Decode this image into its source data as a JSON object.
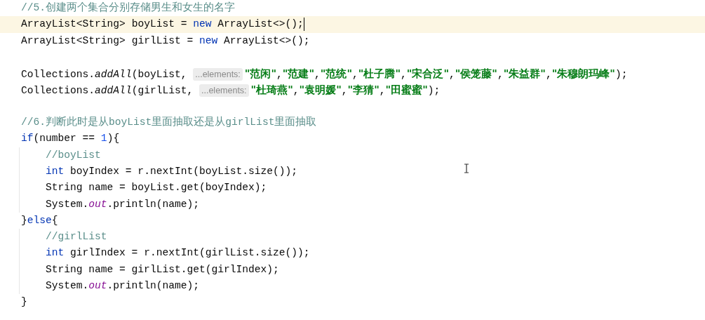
{
  "editor": {
    "lines": [
      {
        "kind": "code",
        "current": false,
        "caret": false,
        "tokens": [
          {
            "t": "//5.创建两个集合分别存储男生和女生的名字",
            "kind": "comment"
          }
        ]
      },
      {
        "kind": "code",
        "current": true,
        "caret": true,
        "tokens": [
          {
            "t": "ArrayList<String> boyList = ",
            "kind": "plain"
          },
          {
            "t": "new",
            "kind": "keyword"
          },
          {
            "t": " ArrayList<>();",
            "kind": "plain"
          }
        ]
      },
      {
        "kind": "code",
        "current": false,
        "caret": false,
        "tokens": [
          {
            "t": "ArrayList<String> girlList = ",
            "kind": "plain"
          },
          {
            "t": "new",
            "kind": "keyword"
          },
          {
            "t": " ArrayList<>();",
            "kind": "plain"
          }
        ]
      },
      {
        "kind": "blank"
      },
      {
        "kind": "code",
        "current": false,
        "caret": false,
        "tokens": [
          {
            "t": "Collections.",
            "kind": "plain"
          },
          {
            "t": "addAll",
            "kind": "static"
          },
          {
            "t": "(boyList, ",
            "kind": "plain"
          },
          {
            "t": "...elements:",
            "kind": "hint"
          },
          {
            "t": "\"范闲\"",
            "kind": "string"
          },
          {
            "t": ",",
            "kind": "plain"
          },
          {
            "t": "\"范建\"",
            "kind": "string"
          },
          {
            "t": ",",
            "kind": "plain"
          },
          {
            "t": "\"范统\"",
            "kind": "string"
          },
          {
            "t": ",",
            "kind": "plain"
          },
          {
            "t": "\"杜子腾\"",
            "kind": "string"
          },
          {
            "t": ",",
            "kind": "plain"
          },
          {
            "t": "\"宋合泛\"",
            "kind": "string"
          },
          {
            "t": ",",
            "kind": "plain"
          },
          {
            "t": "\"侯笼藤\"",
            "kind": "string"
          },
          {
            "t": ",",
            "kind": "plain"
          },
          {
            "t": "\"朱益群\"",
            "kind": "string"
          },
          {
            "t": ",",
            "kind": "plain"
          },
          {
            "t": "\"朱穆朗玛峰\"",
            "kind": "string"
          },
          {
            "t": ");",
            "kind": "plain"
          }
        ]
      },
      {
        "kind": "code",
        "current": false,
        "caret": false,
        "tokens": [
          {
            "t": "Collections.",
            "kind": "plain"
          },
          {
            "t": "addAll",
            "kind": "static"
          },
          {
            "t": "(girlList, ",
            "kind": "plain"
          },
          {
            "t": "...elements:",
            "kind": "hint"
          },
          {
            "t": "\"杜琦燕\"",
            "kind": "string"
          },
          {
            "t": ",",
            "kind": "plain"
          },
          {
            "t": "\"袁明媛\"",
            "kind": "string"
          },
          {
            "t": ",",
            "kind": "plain"
          },
          {
            "t": "\"李猜\"",
            "kind": "string"
          },
          {
            "t": ",",
            "kind": "plain"
          },
          {
            "t": "\"田蜜蜜\"",
            "kind": "string"
          },
          {
            "t": ");",
            "kind": "plain"
          }
        ]
      },
      {
        "kind": "blank"
      },
      {
        "kind": "code",
        "current": false,
        "caret": false,
        "tokens": [
          {
            "t": "//6.判断此时是从boyList里面抽取还是从girlList里面抽取",
            "kind": "comment"
          }
        ]
      },
      {
        "kind": "code",
        "current": false,
        "caret": false,
        "tokens": [
          {
            "t": "if",
            "kind": "keyword"
          },
          {
            "t": "(number == ",
            "kind": "plain"
          },
          {
            "t": "1",
            "kind": "number"
          },
          {
            "t": "){",
            "kind": "plain"
          }
        ],
        "children": [
          {
            "kind": "code",
            "current": false,
            "caret": false,
            "tokens": [
              {
                "t": "//boyList",
                "kind": "comment"
              }
            ]
          },
          {
            "kind": "code",
            "current": false,
            "caret": false,
            "tokens": [
              {
                "t": "int",
                "kind": "keyword"
              },
              {
                "t": " boyIndex = r.nextInt(boyList.size());",
                "kind": "plain"
              }
            ]
          },
          {
            "kind": "code",
            "current": false,
            "caret": false,
            "tokens": [
              {
                "t": "String name = boyList.get(boyIndex);",
                "kind": "plain"
              }
            ]
          },
          {
            "kind": "code",
            "current": false,
            "caret": false,
            "tokens": [
              {
                "t": "System.",
                "kind": "plain"
              },
              {
                "t": "out",
                "kind": "field"
              },
              {
                "t": ".println(name);",
                "kind": "plain"
              }
            ]
          }
        ]
      },
      {
        "kind": "code",
        "current": false,
        "caret": false,
        "tokens": [
          {
            "t": "}",
            "kind": "plain"
          },
          {
            "t": "else",
            "kind": "keyword"
          },
          {
            "t": "{",
            "kind": "plain"
          }
        ],
        "children": [
          {
            "kind": "code",
            "current": false,
            "caret": false,
            "tokens": [
              {
                "t": "//girlList",
                "kind": "comment"
              }
            ]
          },
          {
            "kind": "code",
            "current": false,
            "caret": false,
            "tokens": [
              {
                "t": "int",
                "kind": "keyword"
              },
              {
                "t": " girlIndex = r.nextInt(girlList.size());",
                "kind": "plain"
              }
            ]
          },
          {
            "kind": "code",
            "current": false,
            "caret": false,
            "tokens": [
              {
                "t": "String name = girlList.get(girlIndex);",
                "kind": "plain"
              }
            ]
          },
          {
            "kind": "code",
            "current": false,
            "caret": false,
            "tokens": [
              {
                "t": "System.",
                "kind": "plain"
              },
              {
                "t": "out",
                "kind": "field"
              },
              {
                "t": ".println(name);",
                "kind": "plain"
              }
            ]
          }
        ]
      },
      {
        "kind": "code",
        "current": false,
        "caret": false,
        "tokens": [
          {
            "t": "}",
            "kind": "plain"
          }
        ]
      }
    ]
  }
}
